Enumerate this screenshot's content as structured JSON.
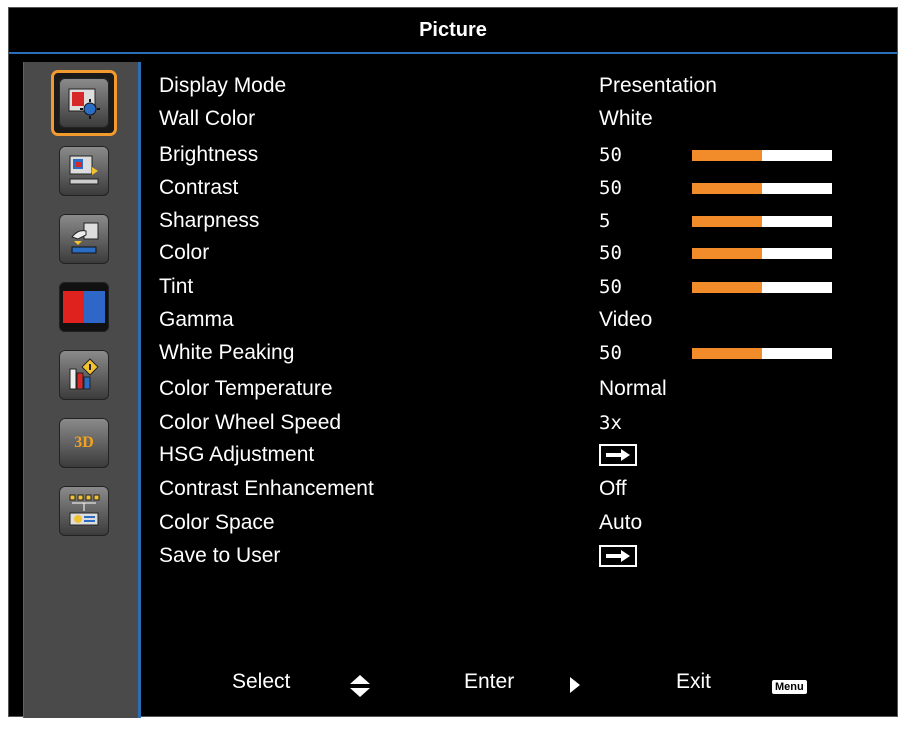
{
  "window": {
    "title": "Picture"
  },
  "sidebar": {
    "items": [
      {
        "name": "picture",
        "icon": "picture-settings-icon",
        "active": true
      },
      {
        "name": "screen",
        "icon": "screen-settings-icon",
        "active": false
      },
      {
        "name": "setting",
        "icon": "hand-setting-icon",
        "active": false
      },
      {
        "name": "color",
        "icon": "color-blocks-icon",
        "active": false
      },
      {
        "name": "options",
        "icon": "options-info-icon",
        "active": false
      },
      {
        "name": "3d",
        "icon": "3d-icon",
        "active": false,
        "text": "3D"
      },
      {
        "name": "network",
        "icon": "network-lan-icon",
        "active": false
      }
    ]
  },
  "menu": {
    "rows": [
      {
        "label": "Display Mode",
        "value": "Presentation"
      },
      {
        "label": "Wall Color",
        "value": "White"
      },
      {
        "label": "Brightness",
        "value": "50",
        "level": 0.5
      },
      {
        "label": "Contrast",
        "value": "50",
        "level": 0.5
      },
      {
        "label": "Sharpness",
        "value": "5",
        "level": 0.5
      },
      {
        "label": "Color",
        "value": "50",
        "level": 0.5
      },
      {
        "label": "Tint",
        "value": "50",
        "level": 0.5
      },
      {
        "label": "Gamma",
        "value": "Video"
      },
      {
        "label": "White Peaking",
        "value": "50",
        "level": 0.5
      },
      {
        "label": "Color Temperature",
        "value": "Normal"
      },
      {
        "label": "Color Wheel Speed",
        "value": "3x"
      },
      {
        "label": "HSG Adjustment",
        "value": "enter-arrow"
      },
      {
        "label": "Contrast Enhancement",
        "value": "Off"
      },
      {
        "label": "Color Space",
        "value": "Auto"
      },
      {
        "label": "Save to User",
        "value": "enter-arrow"
      }
    ]
  },
  "footer": {
    "select_label": "Select",
    "enter_label": "Enter",
    "exit_label": "Exit",
    "menu_key": "Menu"
  },
  "colors": {
    "accent": "#f28b2a",
    "border": "#2a6fb6",
    "sidebar": "#4a4a4a"
  }
}
